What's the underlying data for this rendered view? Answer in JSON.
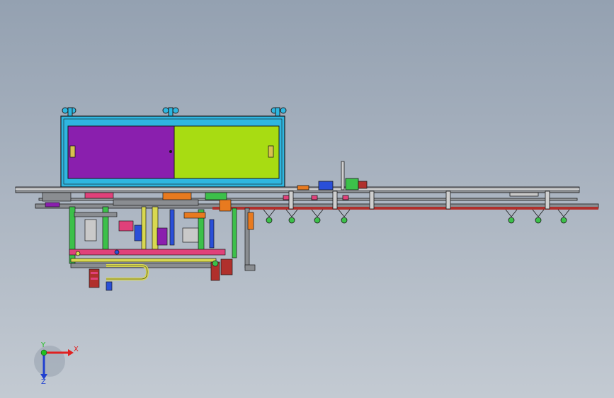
{
  "viewport": {
    "background_top": "#94a1b1",
    "background_bottom": "#c3cad2"
  },
  "model": {
    "cabinet_frame_color": "#2fb6e0",
    "left_door_color": "#8a1fae",
    "right_door_color": "#a8dc12",
    "conveyor_color": "#8a8d91",
    "accent_colors": [
      "#e0417a",
      "#3cc04a",
      "#2a4fd8",
      "#e87a1f",
      "#b0302c",
      "#d8d850"
    ]
  },
  "triad": {
    "x_label": "X",
    "y_label": "Y",
    "z_label": "Z",
    "x_color": "#e02020",
    "y_color": "#20c020",
    "z_color": "#2040d0"
  }
}
